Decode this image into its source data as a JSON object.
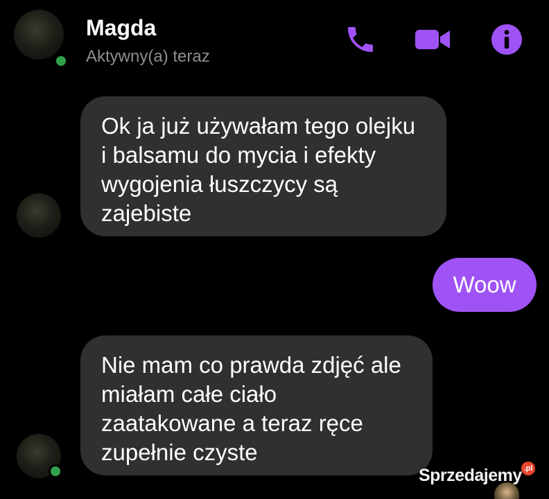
{
  "header": {
    "contact_name": "Magda",
    "status": "Aktywny(a) teraz",
    "icons": [
      "phone-icon",
      "video-camera-icon",
      "info-icon"
    ]
  },
  "messages": [
    {
      "direction": "incoming",
      "lines": [
        "Ok ja już używałam tego olejku",
        "i balsamu do mycia i efekty",
        "wygojenia łuszczycy są",
        "zajebiste"
      ]
    },
    {
      "direction": "outgoing",
      "text": "Woow"
    },
    {
      "direction": "incoming",
      "lines": [
        "Nie mam co prawda zdjęć ale",
        "miałam całe ciało",
        "zaatakowane a teraz ręce",
        "zupełnie czyste"
      ]
    }
  ],
  "watermark": {
    "text": "Sprzedajemy",
    "badge": ".pl"
  },
  "colors": {
    "accent": "#9f53f5",
    "background": "#000000",
    "incoming_bubble": "#303030",
    "online": "#31a24c"
  }
}
